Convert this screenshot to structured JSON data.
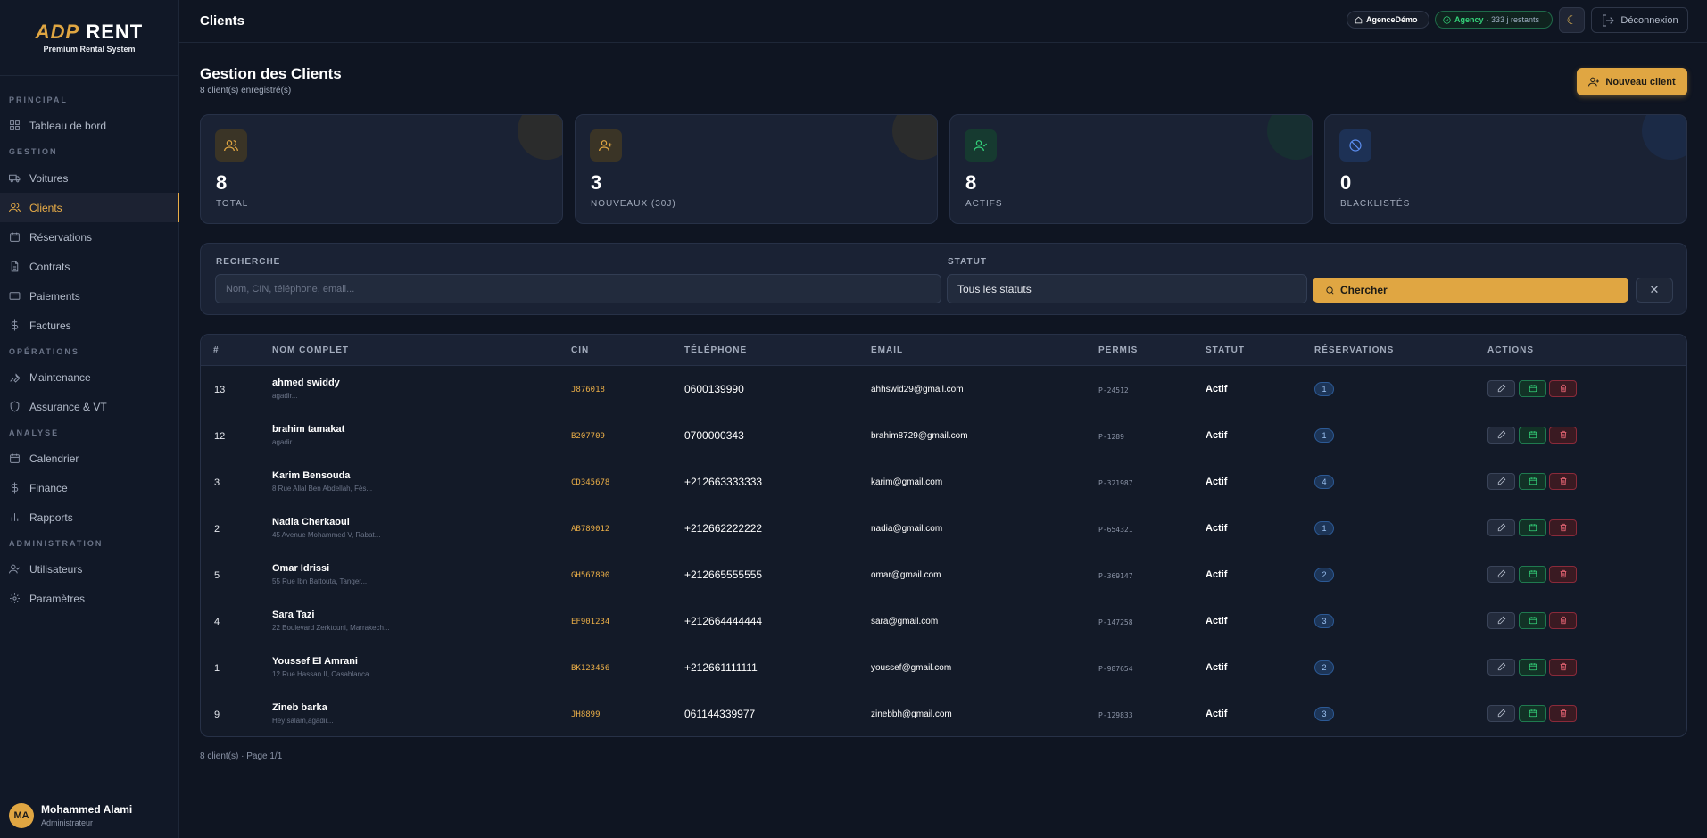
{
  "logo": {
    "part1": "ADP",
    "part2": "RENT",
    "tagline": "Premium Rental System"
  },
  "sidebar": {
    "sections": {
      "principal": "PRINCIPAL",
      "gestion": "GESTION",
      "operations": "OPÉRATIONS",
      "analyse": "ANALYSE",
      "administration": "ADMINISTRATION"
    },
    "items": {
      "dashboard": "Tableau de bord",
      "cars": "Voitures",
      "clients": "Clients",
      "reservations": "Réservations",
      "contracts": "Contrats",
      "payments": "Paiements",
      "invoices": "Factures",
      "maintenance": "Maintenance",
      "insurance": "Assurance & VT",
      "calendar": "Calendrier",
      "finance": "Finance",
      "reports": "Rapports",
      "users": "Utilisateurs",
      "settings": "Paramètres"
    },
    "active": "clients"
  },
  "user": {
    "initials": "MA",
    "name": "Mohammed Alami",
    "role": "Administrateur"
  },
  "topbar": {
    "title": "Clients",
    "agency": "AgenceDémo",
    "plan": "Agency",
    "plan_remaining": "· 333 j restants",
    "theme_icon": "moon-icon",
    "logout": "Déconnexion"
  },
  "page": {
    "title": "Gestion des Clients",
    "subtitle": "8 client(s) enregistré(s)",
    "new_button": "Nouveau client"
  },
  "stats": [
    {
      "value": "8",
      "label": "TOTAL",
      "icon": "users-icon",
      "color": "#e0a642"
    },
    {
      "value": "3",
      "label": "NOUVEAUX (30J)",
      "icon": "user-plus-icon",
      "color": "#e0a642"
    },
    {
      "value": "8",
      "label": "ACTIFS",
      "icon": "user-check-icon",
      "color": "#34d27a"
    },
    {
      "value": "0",
      "label": "BLACKLISTÉS",
      "icon": "ban-icon",
      "color": "#5b8def"
    }
  ],
  "filters": {
    "search_label": "RECHERCHE",
    "search_placeholder": "Nom, CIN, téléphone, email...",
    "status_label": "STATUT",
    "status_value": "Tous les statuts",
    "search_button": "Chercher",
    "clear_icon": "close-icon"
  },
  "table": {
    "columns": [
      "#",
      "NOM COMPLET",
      "CIN",
      "TÉLÉPHONE",
      "EMAIL",
      "PERMIS",
      "STATUT",
      "RÉSERVATIONS",
      "ACTIONS"
    ],
    "rows": [
      {
        "id": "13",
        "name": "ahmed swiddy",
        "address": "agadir...",
        "cin": "J876018",
        "phone": "0600139990",
        "email": "ahhswid29@gmail.com",
        "permis": "P-24512",
        "status": "Actif",
        "reservations": "1"
      },
      {
        "id": "12",
        "name": "brahim tamakat",
        "address": "agadir...",
        "cin": "B207709",
        "phone": "0700000343",
        "email": "brahim8729@gmail.com",
        "permis": "P-1289",
        "status": "Actif",
        "reservations": "1"
      },
      {
        "id": "3",
        "name": "Karim Bensouda",
        "address": "8 Rue Allal Ben Abdellah, Fès...",
        "cin": "CD345678",
        "phone": "+212663333333",
        "email": "karim@gmail.com",
        "permis": "P-321987",
        "status": "Actif",
        "reservations": "4"
      },
      {
        "id": "2",
        "name": "Nadia Cherkaoui",
        "address": "45 Avenue Mohammed V, Rabat...",
        "cin": "AB789012",
        "phone": "+212662222222",
        "email": "nadia@gmail.com",
        "permis": "P-654321",
        "status": "Actif",
        "reservations": "1"
      },
      {
        "id": "5",
        "name": "Omar Idrissi",
        "address": "55 Rue Ibn Battouta, Tanger...",
        "cin": "GH567890",
        "phone": "+212665555555",
        "email": "omar@gmail.com",
        "permis": "P-369147",
        "status": "Actif",
        "reservations": "2"
      },
      {
        "id": "4",
        "name": "Sara Tazi",
        "address": "22 Boulevard Zerktouni, Marrakech...",
        "cin": "EF901234",
        "phone": "+212664444444",
        "email": "sara@gmail.com",
        "permis": "P-147258",
        "status": "Actif",
        "reservations": "3"
      },
      {
        "id": "1",
        "name": "Youssef El Amrani",
        "address": "12 Rue Hassan II, Casablanca...",
        "cin": "BK123456",
        "phone": "+212661111111",
        "email": "youssef@gmail.com",
        "permis": "P-987654",
        "status": "Actif",
        "reservations": "2"
      },
      {
        "id": "9",
        "name": "Zineb barka",
        "address": "Hey salam,agadir...",
        "cin": "JH8899",
        "phone": "061144339977",
        "email": "zinebbh@gmail.com",
        "permis": "P-129833",
        "status": "Actif",
        "reservations": "3"
      }
    ],
    "footer": "8 client(s) · Page 1/1"
  }
}
